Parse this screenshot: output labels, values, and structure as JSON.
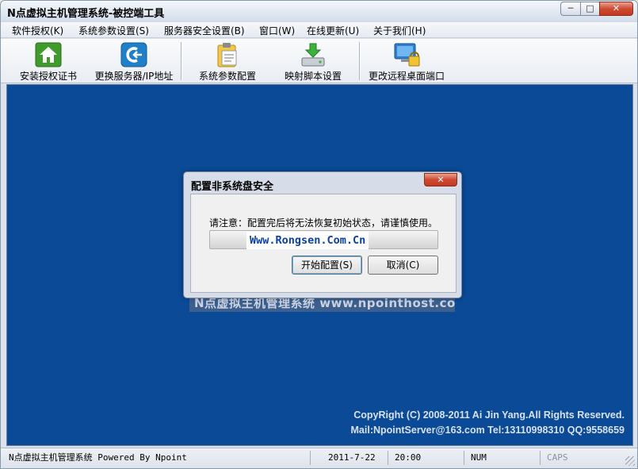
{
  "window": {
    "title": "N点虚拟主机管理系统-被控端工具",
    "min_glyph": "─",
    "max_glyph": "□",
    "close_glyph": "✕"
  },
  "menu": [
    {
      "label": "软件授权(K)"
    },
    {
      "label": "系统参数设置(S)"
    },
    {
      "label": "服务器安全设置(B)"
    },
    {
      "label": "窗口(W)"
    },
    {
      "label": "在线更新(U)"
    },
    {
      "label": "关于我们(H)"
    }
  ],
  "toolbar": [
    {
      "label": "安装授权证书",
      "icon": "home-icon"
    },
    {
      "label": "更换服务器/IP地址",
      "icon": "server-switch-icon"
    },
    {
      "label": "系统参数配置",
      "icon": "clipboard-icon"
    },
    {
      "label": "映射脚本设置",
      "icon": "download-drive-icon"
    },
    {
      "label": "更改远程桌面端口",
      "icon": "remote-desktop-lock-icon"
    }
  ],
  "background": {
    "watermark": "N点虚拟主机管理系统 www.npointhost.com",
    "copyright_line1": "CopyRight (C) 2008-2011 Ai Jin Yang.All Rights Reserved.",
    "copyright_line2": "Mail:NpointServer@163.com Tel:13110998310 QQ:9558659"
  },
  "dialog": {
    "title": "配置非系统盘安全",
    "close_glyph": "✕",
    "notice": "请注意：配置完后将无法恢复初始状态，请谨慎使用。",
    "brand_watermark": "Www.Rongsen.Com.Cn",
    "progress": 0,
    "ok_label": "开始配置(S)",
    "cancel_label": "取消(C)"
  },
  "status": {
    "app": "N点虚拟主机管理系统 Powered By Npoint",
    "date": "2011-7-22",
    "time": "20:00",
    "num": "NUM",
    "caps": "CAPS"
  },
  "colors": {
    "client_bg": "#0a4a96",
    "accent_close": "#cf4a32"
  }
}
